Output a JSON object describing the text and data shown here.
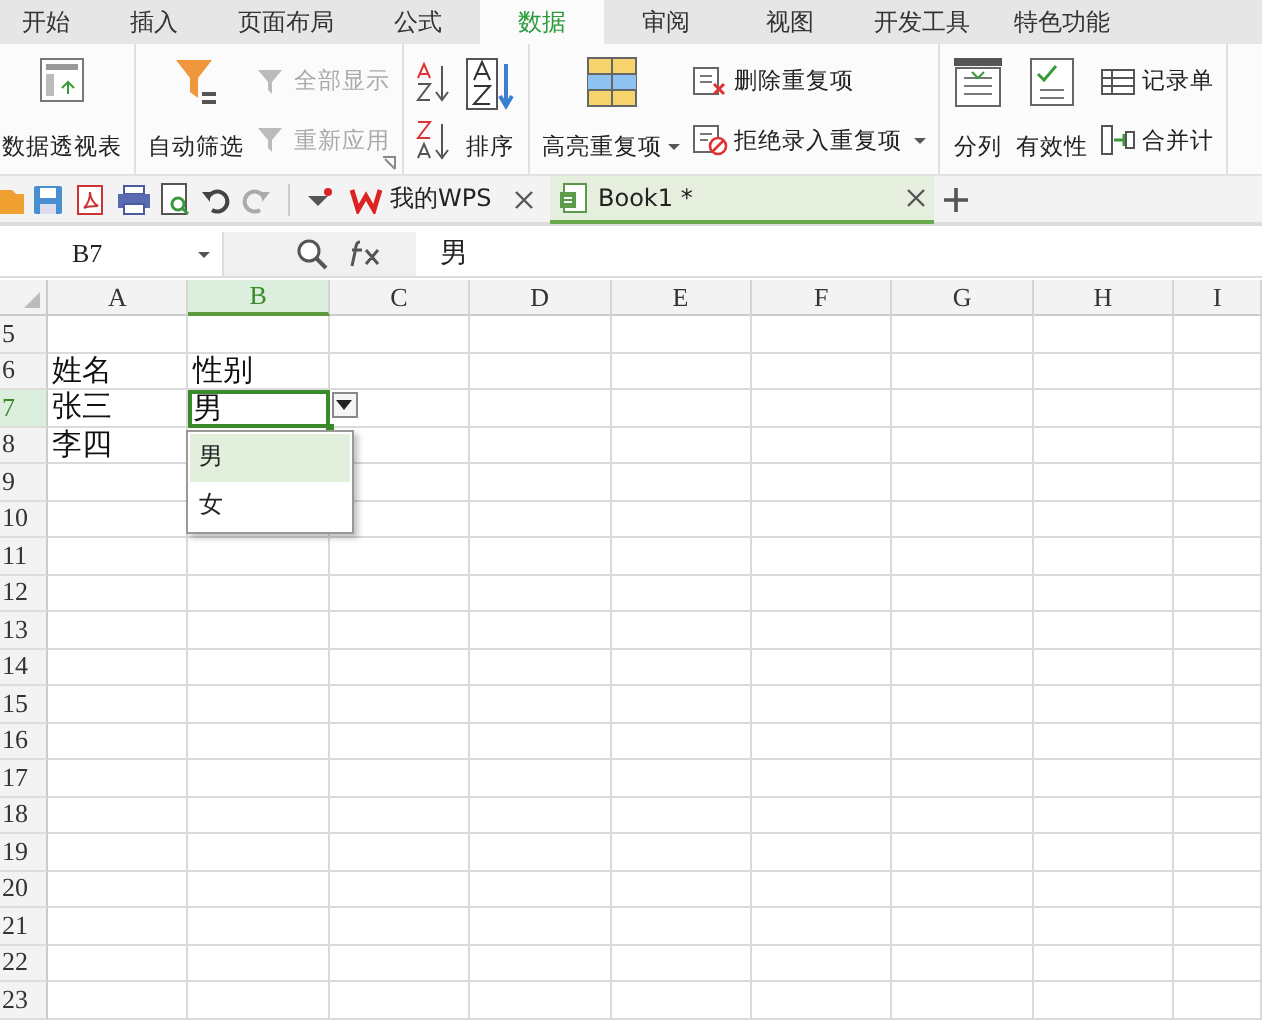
{
  "menu_tabs": [
    {
      "label": "开始",
      "selected": false
    },
    {
      "label": "插入",
      "selected": false
    },
    {
      "label": "页面布局",
      "selected": false
    },
    {
      "label": "公式",
      "selected": false
    },
    {
      "label": "数据",
      "selected": true
    },
    {
      "label": "审阅",
      "selected": false
    },
    {
      "label": "视图",
      "selected": false
    },
    {
      "label": "开发工具",
      "selected": false
    },
    {
      "label": "特色功能",
      "selected": false
    }
  ],
  "ribbon": {
    "groups": [
      {
        "columns": [
          {
            "kind": "large",
            "label": "数据透视表",
            "dropdown": false
          }
        ]
      },
      {
        "launcher": true,
        "columns": [
          {
            "kind": "large",
            "label": "自动筛选",
            "dropdown": false
          },
          {
            "kind": "stack",
            "items": [
              {
                "label": "全部显示",
                "disabled": true,
                "dropdown": false
              },
              {
                "label": "重新应用",
                "disabled": true,
                "dropdown": false
              }
            ]
          }
        ]
      },
      {
        "columns": [
          {
            "kind": "sort"
          },
          {
            "kind": "large",
            "label": "排序",
            "dropdown": false
          }
        ]
      },
      {
        "columns": [
          {
            "kind": "large",
            "label": "高亮重复项",
            "dropdown": true
          },
          {
            "kind": "stack",
            "items": [
              {
                "label": "删除重复项",
                "disabled": false,
                "dropdown": false
              },
              {
                "label": "拒绝录入重复项",
                "disabled": false,
                "dropdown": true
              }
            ]
          }
        ]
      },
      {
        "columns": [
          {
            "kind": "large",
            "label": "分列",
            "dropdown": false
          },
          {
            "kind": "large",
            "label": "有效性",
            "dropdown": false
          },
          {
            "kind": "stack",
            "items": [
              {
                "label": "记录单",
                "disabled": false,
                "dropdown": false
              },
              {
                "label": "合并计",
                "disabled": false,
                "dropdown": false
              }
            ]
          }
        ]
      }
    ]
  },
  "doc_tabs": [
    {
      "label": "我的WPS",
      "kind": "home",
      "selected": false
    },
    {
      "label": "Book1 *",
      "kind": "book",
      "selected": true
    }
  ],
  "formula_bar": {
    "name_box": "B7",
    "value": "男"
  },
  "sheet": {
    "columns": [
      {
        "label": "A",
        "selected": false
      },
      {
        "label": "B",
        "selected": true
      },
      {
        "label": "C",
        "selected": false
      },
      {
        "label": "D",
        "selected": false
      },
      {
        "label": "E",
        "selected": false
      },
      {
        "label": "F",
        "selected": false
      },
      {
        "label": "G",
        "selected": false
      },
      {
        "label": "H",
        "selected": false
      },
      {
        "label": "I",
        "selected": false
      }
    ],
    "rows": [
      {
        "number": "5",
        "selected": false
      },
      {
        "number": "6",
        "selected": false,
        "cells": [
          "姓名",
          "性别"
        ]
      },
      {
        "number": "7",
        "selected": true,
        "cells": [
          "张三",
          "男"
        ]
      },
      {
        "number": "8",
        "selected": false,
        "cells": [
          "李四"
        ]
      },
      {
        "number": "9",
        "selected": false
      },
      {
        "number": "10",
        "selected": false
      },
      {
        "number": "11",
        "selected": false
      },
      {
        "number": "12",
        "selected": false
      },
      {
        "number": "13",
        "selected": false
      },
      {
        "number": "14",
        "selected": false
      },
      {
        "number": "15",
        "selected": false
      },
      {
        "number": "16",
        "selected": false
      },
      {
        "number": "17",
        "selected": false
      },
      {
        "number": "18",
        "selected": false
      },
      {
        "number": "19",
        "selected": false
      },
      {
        "number": "20",
        "selected": false
      },
      {
        "number": "21",
        "selected": false
      },
      {
        "number": "22",
        "selected": false
      },
      {
        "number": "23",
        "selected": false
      }
    ],
    "dropdown_options": [
      {
        "label": "男",
        "selected": true
      },
      {
        "label": "女",
        "selected": false
      }
    ]
  }
}
